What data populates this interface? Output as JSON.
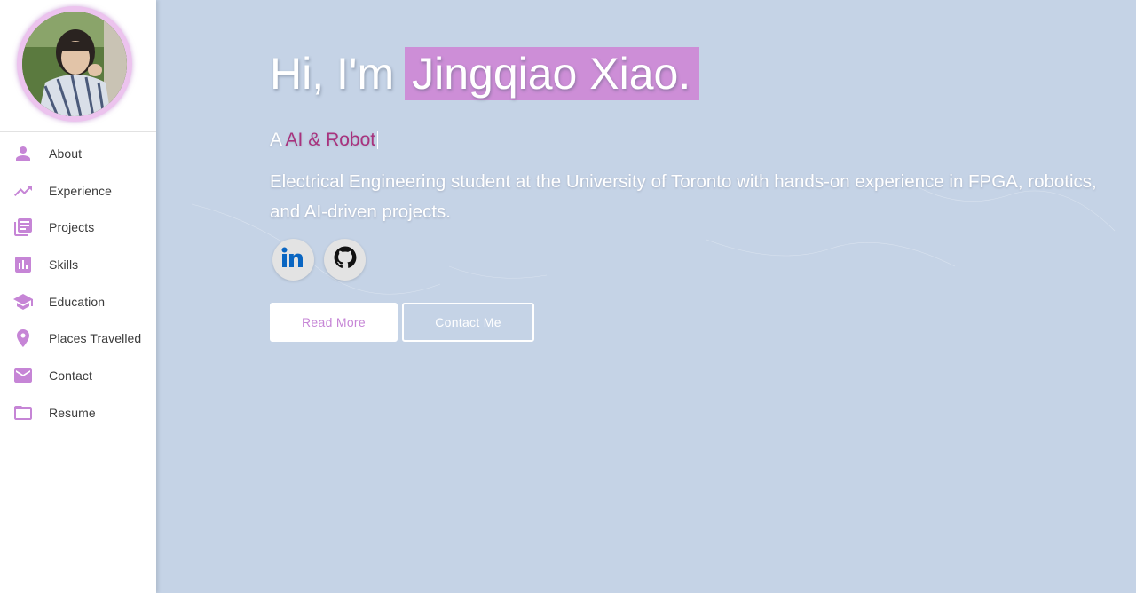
{
  "sidebar": {
    "items": [
      {
        "label": "About",
        "icon": "person-icon"
      },
      {
        "label": "Experience",
        "icon": "trending-up-icon"
      },
      {
        "label": "Projects",
        "icon": "library-books-icon"
      },
      {
        "label": "Skills",
        "icon": "bar-chart-icon"
      },
      {
        "label": "Education",
        "icon": "graduation-cap-icon"
      },
      {
        "label": "Places Travelled",
        "icon": "location-pin-icon"
      },
      {
        "label": "Contact",
        "icon": "mail-icon"
      },
      {
        "label": "Resume",
        "icon": "folder-icon"
      }
    ]
  },
  "hero": {
    "greeting_prefix": "Hi, I'm",
    "name": "Jingqiao Xiao.",
    "tagline_prefix": "A",
    "tagline_typed": "AI & Robot",
    "description": "Electrical Engineering student at the University of Toronto with hands-on experience in FPGA, robotics, and AI-driven projects.",
    "social": [
      {
        "icon": "linkedin-icon"
      },
      {
        "icon": "github-icon"
      }
    ],
    "read_more_label": "Read More",
    "contact_label": "Contact Me"
  },
  "colors": {
    "accent": "#c685d6",
    "name_highlight": "#cd8ed7",
    "typed_text": "#a8327e",
    "background": "#c5d3e6"
  }
}
